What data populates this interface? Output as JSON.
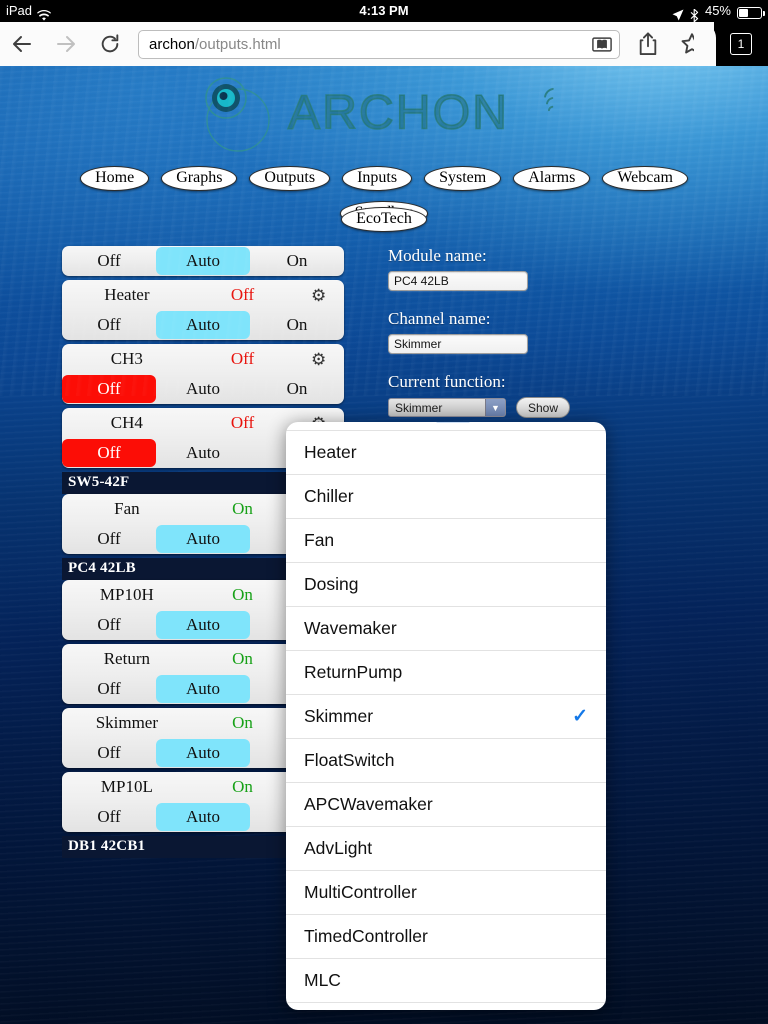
{
  "status_bar": {
    "carrier": "iPad",
    "wifi_icon": "wifi-icon",
    "time": "4:13 PM",
    "location_icon": "location-arrow-icon",
    "bluetooth_icon": "bluetooth-icon",
    "battery_percent": "45%"
  },
  "browser": {
    "back_icon": "back-arrow-icon",
    "forward_icon": "forward-arrow-icon",
    "reload_icon": "reload-icon",
    "url_host": "archon",
    "url_path": "/outputs.html",
    "reader_icon": "reader-view-icon",
    "share_icon": "share-icon",
    "bookmark_icon": "star-icon",
    "tab_count": "1"
  },
  "site": {
    "logo_text": "ARCHON",
    "nav_row1": [
      {
        "label": "Home"
      },
      {
        "label": "Graphs"
      },
      {
        "label": "Outputs"
      },
      {
        "label": "Inputs"
      },
      {
        "label": "System"
      },
      {
        "label": "Alarms"
      },
      {
        "label": "Webcam"
      },
      {
        "label": "Standbys"
      }
    ],
    "nav_row2": [
      {
        "label": "EcoTech"
      }
    ]
  },
  "outputs": {
    "segment_labels": {
      "off": "Off",
      "auto": "Auto",
      "on": "On"
    },
    "gear_icon": "gear-icon",
    "partial_row": {
      "off": "Off",
      "auto": "Auto",
      "on": "On",
      "selected": "auto"
    },
    "items": [
      {
        "type": "channel",
        "name": "Heater",
        "state": "Off",
        "state_kind": "off",
        "selected": "auto",
        "show_on": true
      },
      {
        "type": "channel",
        "name": "CH3",
        "state": "Off",
        "state_kind": "off",
        "selected": "off",
        "show_on": true
      },
      {
        "type": "channel",
        "name": "CH4",
        "state": "Off",
        "state_kind": "off",
        "selected": "off",
        "show_on": false
      },
      {
        "type": "module",
        "name": "SW5-42F"
      },
      {
        "type": "channel",
        "name": "Fan",
        "state": "On",
        "state_kind": "on",
        "selected": "auto",
        "show_on": false
      },
      {
        "type": "module",
        "name": "PC4 42LB"
      },
      {
        "type": "channel",
        "name": "MP10H",
        "state": "On",
        "state_kind": "on",
        "selected": "auto",
        "show_on": false
      },
      {
        "type": "channel",
        "name": "Return",
        "state": "On",
        "state_kind": "on",
        "selected": "auto",
        "show_on": false
      },
      {
        "type": "channel",
        "name": "Skimmer",
        "state": "On",
        "state_kind": "on",
        "selected": "auto",
        "show_on": false
      },
      {
        "type": "channel",
        "name": "MP10L",
        "state": "On",
        "state_kind": "on",
        "selected": "auto",
        "show_on": false
      },
      {
        "type": "module",
        "name": "DB1 42CB1"
      }
    ]
  },
  "form": {
    "module_name_label": "Module name:",
    "module_name_value": "PC4 42LB",
    "channel_name_label": "Channel name:",
    "channel_name_value": "Skimmer",
    "current_function_label": "Current function:",
    "current_function_value": "Skimmer",
    "dropdown_arrow_icon": "chevron-down-icon",
    "show_button_label": "Show"
  },
  "function_popover": {
    "checkmark_icon": "checkmark-icon",
    "selected": "Skimmer",
    "options": [
      {
        "label": "Heater",
        "checked": false
      },
      {
        "label": "Chiller",
        "checked": false
      },
      {
        "label": "Fan",
        "checked": false
      },
      {
        "label": "Dosing",
        "checked": false
      },
      {
        "label": "Wavemaker",
        "checked": false
      },
      {
        "label": "ReturnPump",
        "checked": false
      },
      {
        "label": "Skimmer",
        "checked": true
      },
      {
        "label": "FloatSwitch",
        "checked": false
      },
      {
        "label": "APCWavemaker",
        "checked": false
      },
      {
        "label": "AdvLight",
        "checked": false
      },
      {
        "label": "MultiController",
        "checked": false
      },
      {
        "label": "TimedController",
        "checked": false
      },
      {
        "label": "MLC",
        "checked": false
      }
    ]
  },
  "colors": {
    "accent_auto": "#7fe4fb",
    "accent_off": "#fc0d06",
    "state_on": "#17a117",
    "state_off": "#e8120c",
    "module_header_bg": "#0a1733",
    "popover_check": "#1579e8"
  }
}
